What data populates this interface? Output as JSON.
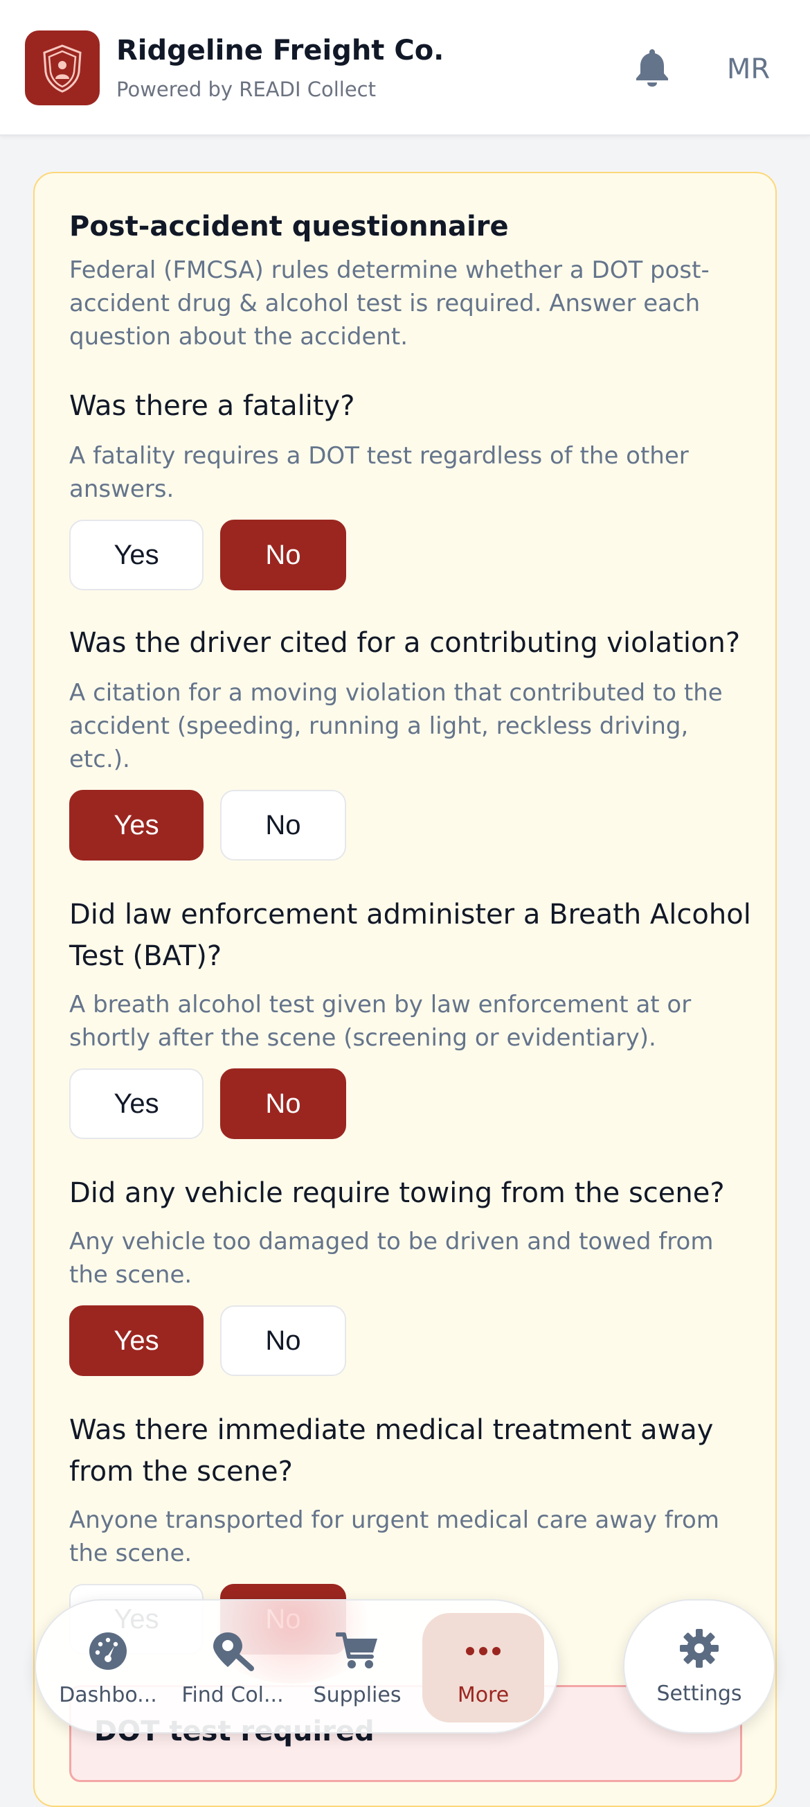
{
  "header": {
    "title": "Ridgeline Freight Co.",
    "subtitle": "Powered by READI Collect",
    "avatar_initials": "MR",
    "brand_color": "#9b2620",
    "logo_icon": "shield-person-icon",
    "notification_icon": "bell-icon"
  },
  "questionnaire": {
    "title": "Post-accident questionnaire",
    "description": "Federal (FMCSA) rules determine whether a DOT post-accident drug & alcohol test is required. Answer each question about the accident.",
    "yes_label": "Yes",
    "no_label": "No",
    "questions": [
      {
        "title": "Was there a fatality?",
        "help": "A fatality requires a DOT test regardless of the other answers.",
        "answer": "No"
      },
      {
        "title": "Was the driver cited for a contributing violation?",
        "help": "A citation for a moving violation that contributed to the accident (speeding, running a light, reckless driving, etc.).",
        "answer": "Yes"
      },
      {
        "title": "Did law enforcement administer a Breath Alcohol Test (BAT)?",
        "help": "A breath alcohol test given by law enforcement at or shortly after the scene (screening or evidentiary).",
        "answer": "No"
      },
      {
        "title": "Did any vehicle require towing from the scene?",
        "help": "Any vehicle too damaged to be driven and towed from the scene.",
        "answer": "Yes"
      },
      {
        "title": "Was there immediate medical treatment away from the scene?",
        "help": "Anyone transported for urgent medical care away from the scene.",
        "answer": "No"
      }
    ]
  },
  "result": {
    "text": "DOT test required"
  },
  "nav": {
    "tabs": [
      {
        "label": "Dashbo...",
        "icon": "dashboard-gauge-icon",
        "active": false
      },
      {
        "label": "Find Col...",
        "icon": "location-search-icon",
        "active": false
      },
      {
        "label": "Supplies",
        "icon": "cart-icon",
        "active": false
      },
      {
        "label": "More",
        "icon": "more-dots-icon",
        "active": true
      }
    ],
    "settings_label": "Settings",
    "settings_icon": "gear-icon"
  }
}
